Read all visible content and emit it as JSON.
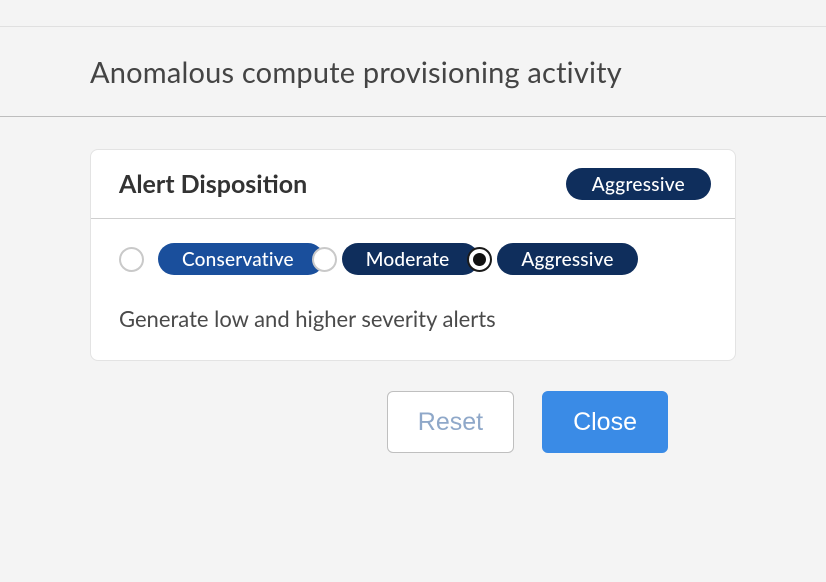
{
  "page": {
    "title": "Anomalous compute provisioning activity"
  },
  "disposition": {
    "heading": "Alert Disposition",
    "current_badge": "Aggressive",
    "options": {
      "conservative": {
        "label": "Conservative",
        "selected": false
      },
      "moderate": {
        "label": "Moderate",
        "selected": true
      },
      "aggressive": {
        "label": "Aggressive",
        "selected": false
      }
    },
    "helper_text": "Generate low and higher severity alerts"
  },
  "actions": {
    "reset_label": "Reset",
    "close_label": "Close"
  },
  "colors": {
    "pill_navy": "#0f2e5c",
    "pill_blue": "#1a4f9c",
    "primary_button": "#3a8be6"
  }
}
